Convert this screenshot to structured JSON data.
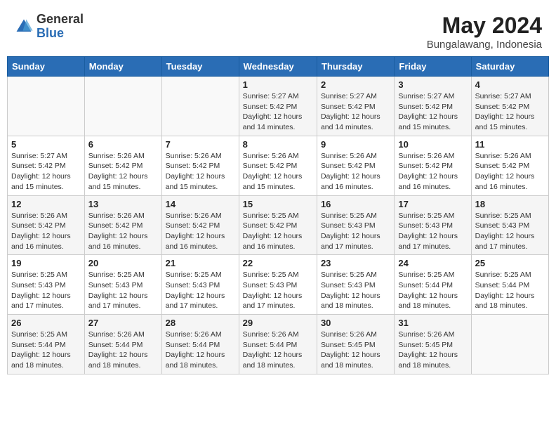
{
  "header": {
    "logo_general": "General",
    "logo_blue": "Blue",
    "title": "May 2024",
    "location": "Bungalawang, Indonesia"
  },
  "weekdays": [
    "Sunday",
    "Monday",
    "Tuesday",
    "Wednesday",
    "Thursday",
    "Friday",
    "Saturday"
  ],
  "weeks": [
    [
      {
        "day": "",
        "info": ""
      },
      {
        "day": "",
        "info": ""
      },
      {
        "day": "",
        "info": ""
      },
      {
        "day": "1",
        "info": "Sunrise: 5:27 AM\nSunset: 5:42 PM\nDaylight: 12 hours\nand 14 minutes."
      },
      {
        "day": "2",
        "info": "Sunrise: 5:27 AM\nSunset: 5:42 PM\nDaylight: 12 hours\nand 14 minutes."
      },
      {
        "day": "3",
        "info": "Sunrise: 5:27 AM\nSunset: 5:42 PM\nDaylight: 12 hours\nand 15 minutes."
      },
      {
        "day": "4",
        "info": "Sunrise: 5:27 AM\nSunset: 5:42 PM\nDaylight: 12 hours\nand 15 minutes."
      }
    ],
    [
      {
        "day": "5",
        "info": "Sunrise: 5:27 AM\nSunset: 5:42 PM\nDaylight: 12 hours\nand 15 minutes."
      },
      {
        "day": "6",
        "info": "Sunrise: 5:26 AM\nSunset: 5:42 PM\nDaylight: 12 hours\nand 15 minutes."
      },
      {
        "day": "7",
        "info": "Sunrise: 5:26 AM\nSunset: 5:42 PM\nDaylight: 12 hours\nand 15 minutes."
      },
      {
        "day": "8",
        "info": "Sunrise: 5:26 AM\nSunset: 5:42 PM\nDaylight: 12 hours\nand 15 minutes."
      },
      {
        "day": "9",
        "info": "Sunrise: 5:26 AM\nSunset: 5:42 PM\nDaylight: 12 hours\nand 16 minutes."
      },
      {
        "day": "10",
        "info": "Sunrise: 5:26 AM\nSunset: 5:42 PM\nDaylight: 12 hours\nand 16 minutes."
      },
      {
        "day": "11",
        "info": "Sunrise: 5:26 AM\nSunset: 5:42 PM\nDaylight: 12 hours\nand 16 minutes."
      }
    ],
    [
      {
        "day": "12",
        "info": "Sunrise: 5:26 AM\nSunset: 5:42 PM\nDaylight: 12 hours\nand 16 minutes."
      },
      {
        "day": "13",
        "info": "Sunrise: 5:26 AM\nSunset: 5:42 PM\nDaylight: 12 hours\nand 16 minutes."
      },
      {
        "day": "14",
        "info": "Sunrise: 5:26 AM\nSunset: 5:42 PM\nDaylight: 12 hours\nand 16 minutes."
      },
      {
        "day": "15",
        "info": "Sunrise: 5:25 AM\nSunset: 5:42 PM\nDaylight: 12 hours\nand 16 minutes."
      },
      {
        "day": "16",
        "info": "Sunrise: 5:25 AM\nSunset: 5:43 PM\nDaylight: 12 hours\nand 17 minutes."
      },
      {
        "day": "17",
        "info": "Sunrise: 5:25 AM\nSunset: 5:43 PM\nDaylight: 12 hours\nand 17 minutes."
      },
      {
        "day": "18",
        "info": "Sunrise: 5:25 AM\nSunset: 5:43 PM\nDaylight: 12 hours\nand 17 minutes."
      }
    ],
    [
      {
        "day": "19",
        "info": "Sunrise: 5:25 AM\nSunset: 5:43 PM\nDaylight: 12 hours\nand 17 minutes."
      },
      {
        "day": "20",
        "info": "Sunrise: 5:25 AM\nSunset: 5:43 PM\nDaylight: 12 hours\nand 17 minutes."
      },
      {
        "day": "21",
        "info": "Sunrise: 5:25 AM\nSunset: 5:43 PM\nDaylight: 12 hours\nand 17 minutes."
      },
      {
        "day": "22",
        "info": "Sunrise: 5:25 AM\nSunset: 5:43 PM\nDaylight: 12 hours\nand 17 minutes."
      },
      {
        "day": "23",
        "info": "Sunrise: 5:25 AM\nSunset: 5:43 PM\nDaylight: 12 hours\nand 18 minutes."
      },
      {
        "day": "24",
        "info": "Sunrise: 5:25 AM\nSunset: 5:44 PM\nDaylight: 12 hours\nand 18 minutes."
      },
      {
        "day": "25",
        "info": "Sunrise: 5:25 AM\nSunset: 5:44 PM\nDaylight: 12 hours\nand 18 minutes."
      }
    ],
    [
      {
        "day": "26",
        "info": "Sunrise: 5:25 AM\nSunset: 5:44 PM\nDaylight: 12 hours\nand 18 minutes."
      },
      {
        "day": "27",
        "info": "Sunrise: 5:26 AM\nSunset: 5:44 PM\nDaylight: 12 hours\nand 18 minutes."
      },
      {
        "day": "28",
        "info": "Sunrise: 5:26 AM\nSunset: 5:44 PM\nDaylight: 12 hours\nand 18 minutes."
      },
      {
        "day": "29",
        "info": "Sunrise: 5:26 AM\nSunset: 5:44 PM\nDaylight: 12 hours\nand 18 minutes."
      },
      {
        "day": "30",
        "info": "Sunrise: 5:26 AM\nSunset: 5:45 PM\nDaylight: 12 hours\nand 18 minutes."
      },
      {
        "day": "31",
        "info": "Sunrise: 5:26 AM\nSunset: 5:45 PM\nDaylight: 12 hours\nand 18 minutes."
      },
      {
        "day": "",
        "info": ""
      }
    ]
  ]
}
